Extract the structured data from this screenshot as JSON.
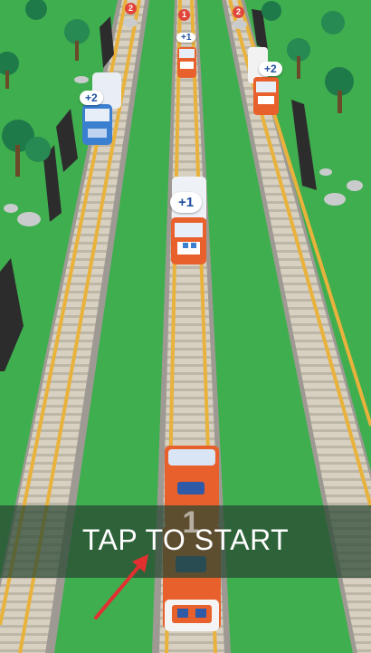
{
  "hud": {
    "prompt": "TAP TO START"
  },
  "player_train": {
    "number": "1"
  },
  "trains": [
    {
      "badge": "+1"
    },
    {
      "badge": "+1"
    },
    {
      "badge": "+2"
    },
    {
      "badge": "+2"
    }
  ],
  "markers": [
    {
      "count": "2"
    },
    {
      "count": "1"
    },
    {
      "count": "2"
    }
  ],
  "colors": {
    "grass": "#3fae4f",
    "rail": "#e8b23c",
    "sleeper": "#d9d2c4",
    "orange_train": "#e8602c",
    "blue_train": "#3a7fd0",
    "arrow": "#e23030"
  }
}
